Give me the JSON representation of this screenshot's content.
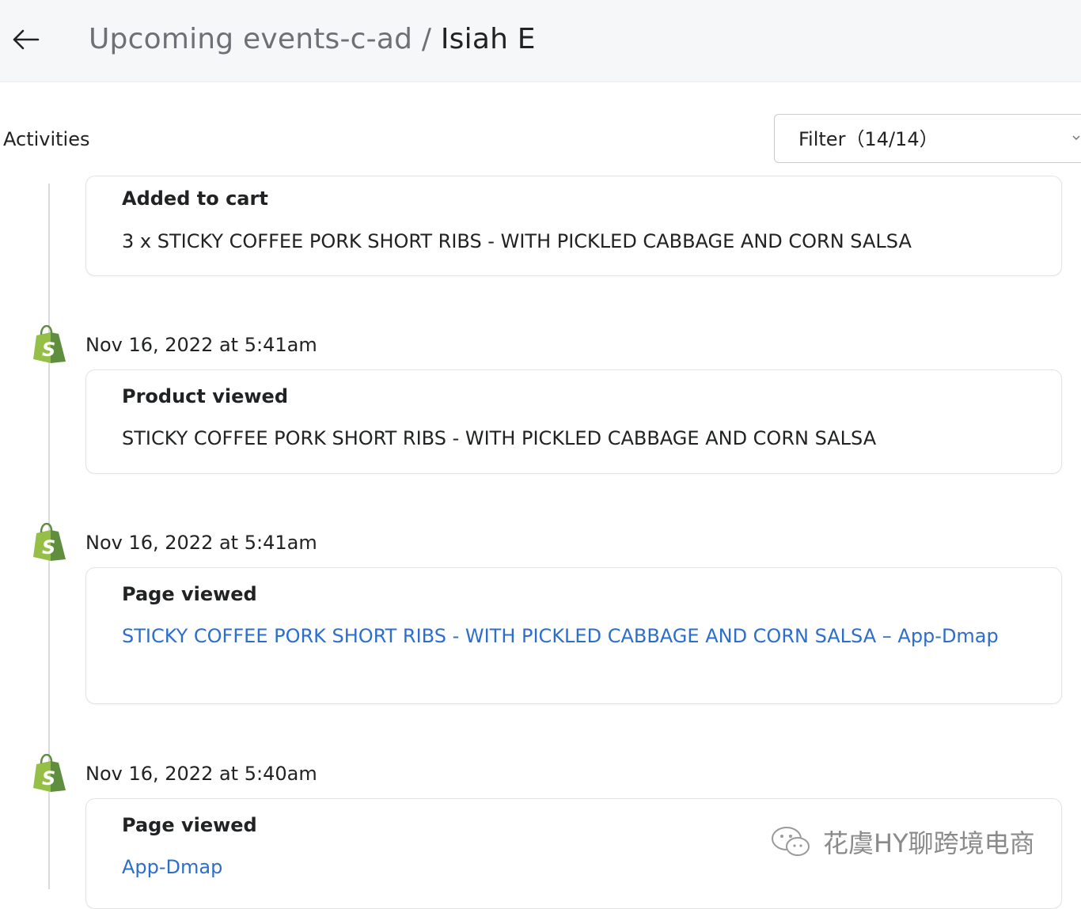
{
  "header": {
    "back_icon": "arrow-left-icon",
    "breadcrumb": "Upcoming events-c-ad",
    "separator": "/",
    "customer_name": "Isiah E"
  },
  "activities": {
    "label": "Activities",
    "filter_label": "Filter（14/14）"
  },
  "events": [
    {
      "title": "Added to cart",
      "detail": "3 x STICKY COFFEE PORK SHORT RIBS - WITH PICKLED CABBAGE AND CORN SALSA"
    },
    {
      "timestamp": "Nov 16, 2022 at 5:41am",
      "icon": "shopify-bag-icon",
      "title": "Product viewed",
      "detail": "STICKY COFFEE PORK SHORT RIBS - WITH PICKLED CABBAGE AND CORN SALSA"
    },
    {
      "timestamp": "Nov 16, 2022 at 5:41am",
      "icon": "shopify-bag-icon",
      "title": "Page viewed",
      "link": "STICKY COFFEE PORK SHORT RIBS - WITH PICKLED CABBAGE AND CORN SALSA – App-Dmap"
    },
    {
      "timestamp": "Nov 16, 2022 at 5:40am",
      "icon": "shopify-bag-icon",
      "title": "Page viewed",
      "link": "App-Dmap"
    }
  ],
  "watermark": {
    "icon": "wechat-icon",
    "text": "花虞HY聊跨境电商"
  },
  "colors": {
    "link": "#2c6ecb",
    "shopify_green": "#95bf47",
    "shopify_dark_green": "#5e8e3e"
  }
}
